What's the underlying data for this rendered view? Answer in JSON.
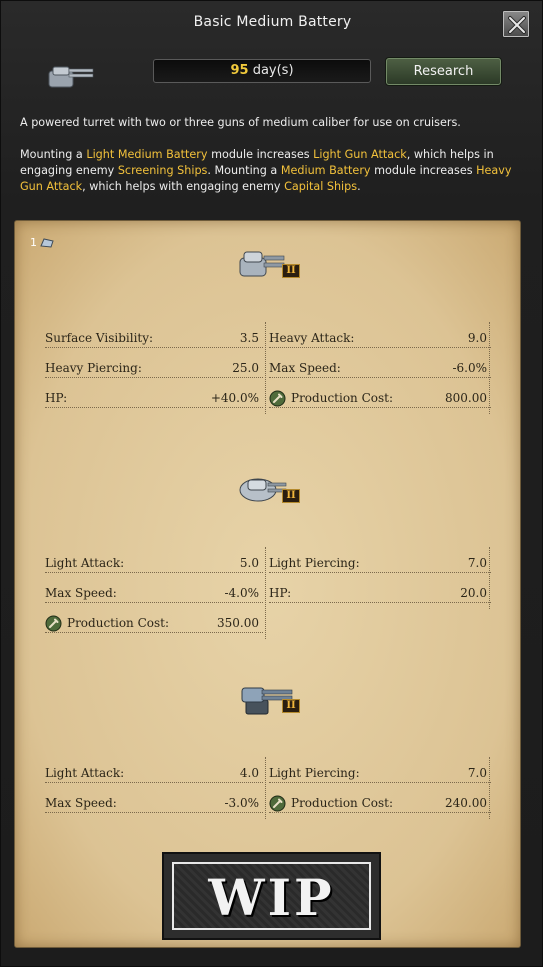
{
  "window": {
    "title": "Basic Medium Battery",
    "days_value": "95",
    "days_unit": " day(s)",
    "research_label": "Research"
  },
  "description": {
    "line1": "A powered turret with two or three guns of medium caliber for use on cruisers.",
    "p2": [
      {
        "t": "Mounting a ",
        "h": false
      },
      {
        "t": "Light Medium Battery",
        "h": true
      },
      {
        "t": " module increases ",
        "h": false
      },
      {
        "t": "Light Gun Attack",
        "h": true
      },
      {
        "t": ", which helps in engaging enemy ",
        "h": false
      },
      {
        "t": "Screening Ships",
        "h": true
      },
      {
        "t": ". Mounting a ",
        "h": false
      },
      {
        "t": "Medium Battery",
        "h": true
      },
      {
        "t": " module increases ",
        "h": false
      },
      {
        "t": "Heavy Gun Attack",
        "h": true
      },
      {
        "t": ", which helps with engaging enemy ",
        "h": false
      },
      {
        "t": "Capital Ships",
        "h": true
      },
      {
        "t": ".",
        "h": false
      }
    ]
  },
  "badge_count": "1",
  "modules": [
    {
      "icon": "heavy-turret-icon",
      "tier": "II",
      "stats_left": [
        {
          "label": "Surface Visibility:",
          "value": "3.5"
        },
        {
          "label": "Heavy Piercing:",
          "value": "25.0"
        },
        {
          "label": "HP:",
          "value": "+40.0%"
        }
      ],
      "stats_right": [
        {
          "label": "Heavy Attack:",
          "value": "9.0"
        },
        {
          "label": "Max Speed:",
          "value": "-6.0%"
        },
        {
          "label": "Production Cost:",
          "value": "800.00",
          "cost": true
        }
      ]
    },
    {
      "icon": "medium-turret-icon",
      "tier": "II",
      "stats_left": [
        {
          "label": "Light Attack:",
          "value": "5.0"
        },
        {
          "label": "Max Speed:",
          "value": "-4.0%"
        },
        {
          "label": "Production Cost:",
          "value": "350.00",
          "cost": true
        }
      ],
      "stats_right": [
        {
          "label": "Light Piercing:",
          "value": "7.0"
        },
        {
          "label": "HP:",
          "value": "20.0"
        }
      ]
    },
    {
      "icon": "light-turret-icon",
      "tier": "II",
      "stats_left": [
        {
          "label": "Light Attack:",
          "value": "4.0"
        },
        {
          "label": "Max Speed:",
          "value": "-3.0%"
        }
      ],
      "stats_right": [
        {
          "label": "Light Piercing:",
          "value": "7.0"
        },
        {
          "label": "Production Cost:",
          "value": "240.00",
          "cost": true
        }
      ]
    }
  ],
  "wip_label": "WIP",
  "colors": {
    "highlight": "#f2c13b",
    "days": "#f0c93c",
    "research": "#3b4b34",
    "parchment": "#dcc394"
  }
}
